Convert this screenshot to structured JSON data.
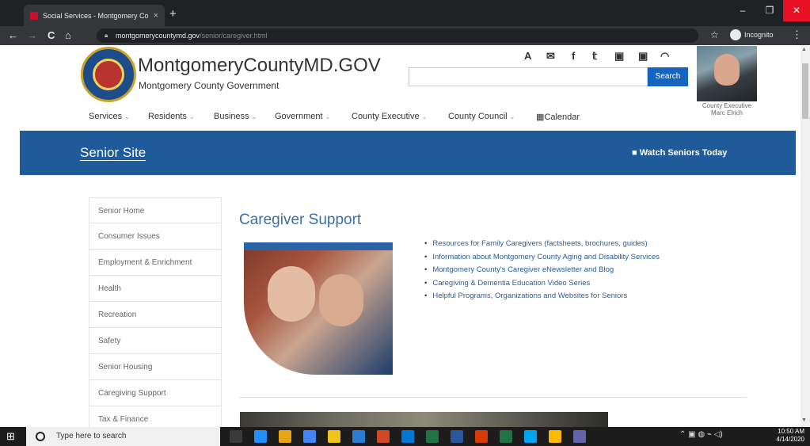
{
  "browser": {
    "tab_title": "Social Services - Montgomery Co",
    "tab_close": "×",
    "new_tab": "+",
    "minimize": "–",
    "restore": "❐",
    "close": "✕",
    "back": "←",
    "forward": "→",
    "reload": "C",
    "home": "⌂",
    "url_domain": "montgomerycountymd.gov",
    "url_path": "/senior/caregiver.html",
    "bookmark": "☆",
    "incognito_label": "Incognito",
    "menu": "⋮"
  },
  "header": {
    "site_title": "MontgomeryCountyMD.GOV",
    "site_subtitle": "Montgomery County Government",
    "social_icons": [
      "A",
      "✉",
      "f",
      "𝕥",
      "▣",
      "▣",
      "◠"
    ],
    "search_placeholder": "",
    "search_button": "Search",
    "exec_caption_1": "County Executive",
    "exec_caption_2": "Marc Elrich"
  },
  "nav": {
    "items": [
      "Services",
      "Residents",
      "Business",
      "Government",
      "County Executive",
      "County Council",
      "Calendar"
    ],
    "calendar_icon": "▦"
  },
  "banner": {
    "title": "Senior Site",
    "video_link": "■ Watch Seniors Today"
  },
  "sidebar": {
    "items": [
      "Senior Home",
      "Consumer Issues",
      "Employment & Enrichment",
      "Health",
      "Recreation",
      "Safety",
      "Senior Housing",
      "Caregiving Support",
      "Tax & Finance"
    ]
  },
  "content": {
    "title": "Caregiver Support",
    "links": [
      "Resources for Family Caregivers (factsheets, brochures, guides)",
      "Information about Montgomery County Aging and Disability Services",
      "Montgomery County's Caregiver eNewsletter and Blog",
      "Caregiving & Dementia Education Video Series",
      "Helpful Programs, Organizations and Websites for Seniors"
    ]
  },
  "taskbar": {
    "start": "⊞",
    "search_placeholder": "Type here to search",
    "tray": "⌃  ▣  ◍  ⌁  ◁)",
    "time": "10:50 AM",
    "date": "4/14/2020",
    "app_colors": [
      "#3a3a3a",
      "#1e90ff",
      "#e8a317",
      "#4285f4",
      "#f0c419",
      "#2b7cd3",
      "#d24726",
      "#0078d4",
      "#217346",
      "#2b579a",
      "#d83b01",
      "#217346",
      "#00a4ef",
      "#ffb900",
      "#6264a7"
    ]
  }
}
